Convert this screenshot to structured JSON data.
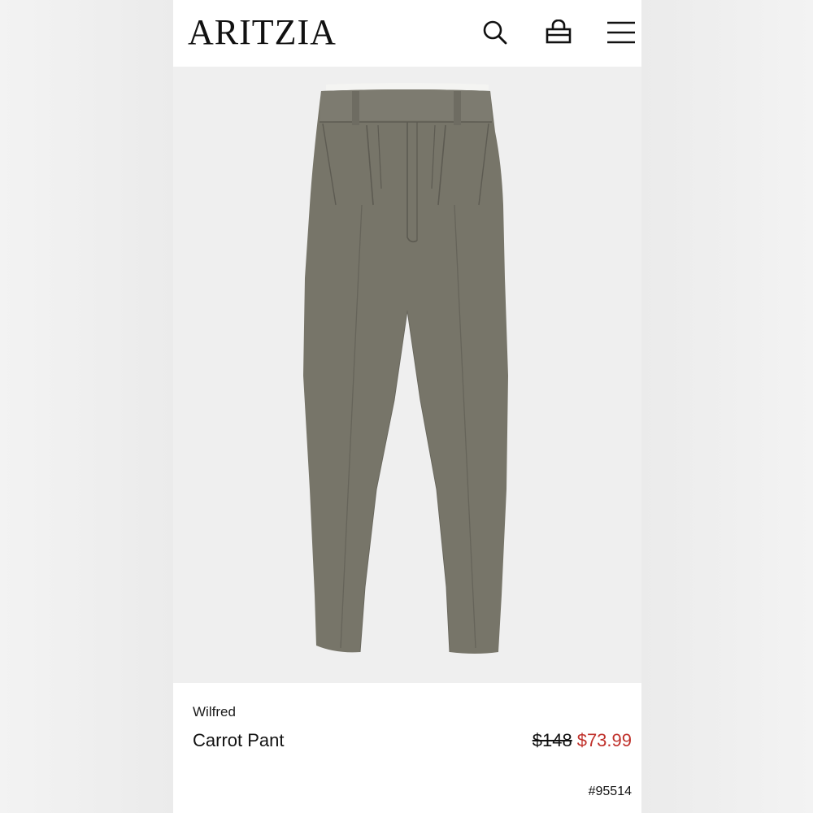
{
  "header": {
    "logo": "ARITZIA",
    "icons": [
      "search-icon",
      "bag-icon",
      "menu-icon"
    ]
  },
  "product": {
    "image_alt": "gray pleated pants",
    "brand": "Wilfred",
    "name": "Carrot Pant",
    "original_price": "$148",
    "sale_price": "$73.99",
    "listing_id": "#95514"
  },
  "colors": {
    "sale_red": "#c0312b",
    "pant_gray": "#777569",
    "background": "#efefef"
  }
}
